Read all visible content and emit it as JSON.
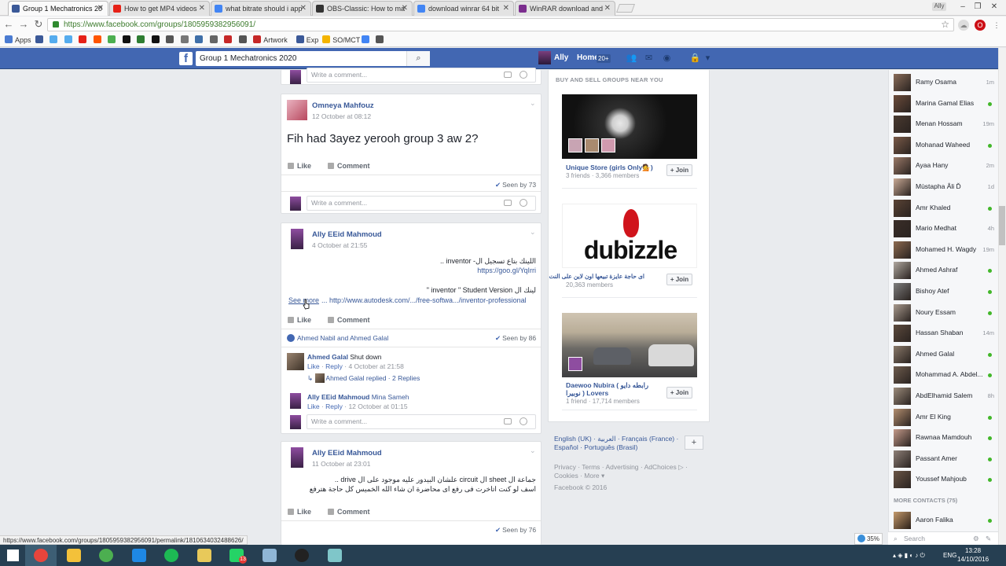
{
  "browser": {
    "tabs": [
      {
        "title": "Group 1 Mechatronics 20",
        "color": "#3b5998",
        "active": true
      },
      {
        "title": "How to get MP4 videos",
        "color": "#e62117",
        "active": false
      },
      {
        "title": "what bitrate should i app",
        "color": "#4285f4",
        "active": false
      },
      {
        "title": "OBS-Classic: How to ma",
        "color": "#333333",
        "active": false
      },
      {
        "title": "download winrar 64 bit",
        "color": "#4285f4",
        "active": false
      },
      {
        "title": "WinRAR download and",
        "color": "#7b2d8e",
        "active": false
      }
    ],
    "profile_label": "Ally",
    "url": "https://www.facebook.com/groups/1805959382956091/",
    "bookmarks": [
      {
        "label": "Apps",
        "icon": "apps-grid-icon",
        "color": "#4a7bd1"
      },
      {
        "label": "",
        "icon": "facebook-icon",
        "color": "#3b5998"
      },
      {
        "label": "",
        "icon": "twitter-icon",
        "color": "#55acee"
      },
      {
        "label": "",
        "icon": "twitter-icon",
        "color": "#55acee"
      },
      {
        "label": "",
        "icon": "youtube-icon",
        "color": "#e62117"
      },
      {
        "label": "",
        "icon": "soundcloud-icon",
        "color": "#ff5500"
      },
      {
        "label": "",
        "icon": "bookmark-icon",
        "color": "#4caf50"
      },
      {
        "label": "",
        "icon": "bookmark-icon",
        "color": "#111111"
      },
      {
        "label": "",
        "icon": "bookmark-icon",
        "color": "#2e7d32"
      },
      {
        "label": "",
        "icon": "bookmark-icon",
        "color": "#111111"
      },
      {
        "label": "",
        "icon": "bookmark-icon",
        "color": "#555555"
      },
      {
        "label": "",
        "icon": "bookmark-icon",
        "color": "#777777"
      },
      {
        "label": "",
        "icon": "bookmark-icon",
        "color": "#3f6fa8"
      },
      {
        "label": "",
        "icon": "bookmark-icon",
        "color": "#666666"
      },
      {
        "label": "",
        "icon": "bookmark-icon",
        "color": "#c62828"
      },
      {
        "label": "",
        "icon": "bookmark-icon",
        "color": "#555555"
      },
      {
        "label": "Artwork",
        "icon": "artwork-icon",
        "color": "#c62828"
      },
      {
        "label": "Exp",
        "icon": "facebook-icon",
        "color": "#3b5998"
      },
      {
        "label": "SO/MCT",
        "icon": "drive-icon",
        "color": "#f4b400"
      },
      {
        "label": "",
        "icon": "bookmark-icon",
        "color": "#4285f4"
      },
      {
        "label": "",
        "icon": "cart-icon",
        "color": "#555555"
      }
    ],
    "status_url": "https://www.facebook.com/groups/1805959382956091/permalink/1810634032488626/",
    "zoom": "35%"
  },
  "facebook": {
    "search_value": "Group 1 Mechatronics 2020",
    "user_name": "Ally",
    "home_label": "Home",
    "home_badge": "20+"
  },
  "feed": {
    "top_comment_placeholder": "Write a comment...",
    "posts": [
      {
        "author": "Omneya Mahfouz",
        "time": "12 October at 08:12",
        "text": "Fih had 3ayez yerooh group 3 aw 2?",
        "like": "Like",
        "comment": "Comment",
        "seen": "Seen by 73",
        "comment_placeholder": "Write a comment..."
      },
      {
        "author": "Ally EEid Mahmoud",
        "time": "4 October at 21:55",
        "line1": "اللينك بتاع تسجيل ال- inventor ..",
        "line2": "https://goo.gl/YqIrri",
        "line3": "لينك ال inventor \" Student Version \"",
        "see_more": "See more",
        "line4": "... http://www.autodesk.com/.../free-softwa.../inventor-professional",
        "like": "Like",
        "comment": "Comment",
        "likers": "Ahmed Nabil and Ahmed Galal",
        "seen": "Seen by 86",
        "comments": [
          {
            "name": "Ahmed Galal",
            "text": "Shut down",
            "like": "Like",
            "reply": "Reply",
            "time": "4 October at 21:58",
            "replies": "Ahmed Galal replied · 2 Replies"
          },
          {
            "name": "Ally EEid Mahmoud",
            "text": "Mina Sameh",
            "like": "Like",
            "reply": "Reply",
            "time": "12 October at 01:15"
          }
        ],
        "comment_placeholder": "Write a comment..."
      },
      {
        "author": "Ally EEid Mahmoud",
        "time": "11 October at 23:01",
        "line1": "جماعة ال sheet ال circuit علشان البيدور عليه موجود على ال drive ..",
        "line2": "اسف لو كنت اتاخرت فى رفع اى محاضرة ان شاء الله الخميس كل حاجة هترفع",
        "like": "Like",
        "comment": "Comment",
        "seen": "Seen by 76"
      }
    ]
  },
  "groups_column": {
    "heading": "BUY AND SELL GROUPS NEAR YOU",
    "groups": [
      {
        "name": "Unique Store (girls Only💁)",
        "members": "3 friends · 3,366 members",
        "join": "Join"
      },
      {
        "name": "اى حاجة عايزة تبيعها اون لاين على النت",
        "members": "20,363 members",
        "join": "Join",
        "logo_text": "dubizzle"
      },
      {
        "name": "Daewoo Nubira ( رابطه دايو نوبيرا ) Lovers",
        "members": "1 friend · 17,714 members",
        "join": "Join"
      }
    ],
    "languages": "English (UK) · العربية · Français (France) · Español · Português (Brasil)",
    "footer_links": "Privacy · Terms · Advertising · AdChoices ▷ · Cookies · More ▾",
    "copyright": "Facebook © 2016"
  },
  "chat": {
    "contacts": [
      {
        "name": "Ramy Osama",
        "status": "1m"
      },
      {
        "name": "Marina Gamal Elias",
        "status": "online"
      },
      {
        "name": "Menan Hossam",
        "status": "19m"
      },
      {
        "name": "Mohanad Waheed",
        "status": "online"
      },
      {
        "name": "Ayaa Hany",
        "status": "2m"
      },
      {
        "name": "Mùstapha Âli Ď",
        "status": "1d"
      },
      {
        "name": "Amr Khaled",
        "status": "online"
      },
      {
        "name": "Mario Medhat",
        "status": "4h"
      },
      {
        "name": "Mohamed H. Wagdy",
        "status": "19m"
      },
      {
        "name": "Ahmed Ashraf",
        "status": "online"
      },
      {
        "name": "Bishoy Atef",
        "status": "online"
      },
      {
        "name": "Noury Essam",
        "status": "online"
      },
      {
        "name": "Hassan Shaban",
        "status": "14m"
      },
      {
        "name": "Ahmed Galal",
        "status": "online"
      },
      {
        "name": "Mohammad A. Abdel...",
        "status": "online"
      },
      {
        "name": "AbdElhamid Salem",
        "status": "8h"
      },
      {
        "name": "Amr El King",
        "status": "online"
      },
      {
        "name": "Rawnaa Mamdouh",
        "status": "online"
      },
      {
        "name": "Passant Amer",
        "status": "online"
      },
      {
        "name": "Youssef Mahjoub",
        "status": "online"
      }
    ],
    "more_contacts": "MORE CONTACTS (75)",
    "more": [
      {
        "name": "Aaron Falika",
        "status": "online"
      }
    ],
    "search_placeholder": "Search"
  },
  "taskbar": {
    "apps": [
      "windows-start-icon",
      "chrome-icon",
      "file-explorer-icon",
      "utorrent-icon",
      "teamviewer-icon",
      "spotify-icon",
      "folder-icon",
      "whatsapp-icon",
      "notepad-icon",
      "obs-icon",
      "app-icon"
    ],
    "whatsapp_badge": "13",
    "language": "ENG",
    "time": "13:28",
    "date": "14/10/2016"
  }
}
